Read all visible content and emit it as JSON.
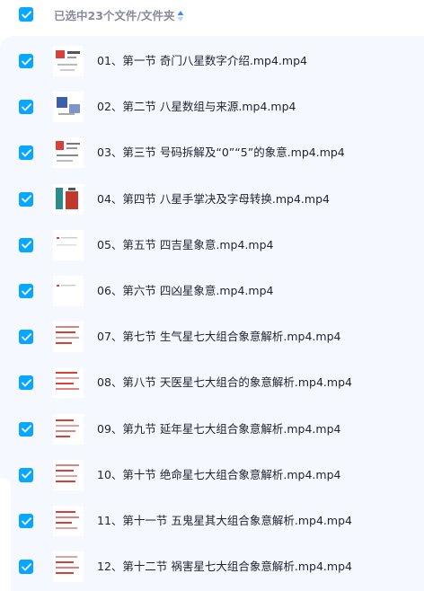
{
  "header": {
    "title": "已选中23个文件/文件夹",
    "checked": true,
    "sort_icon": "sort-up-down-icon",
    "accent_color": "#06a7ff"
  },
  "files": [
    {
      "name": "01、第一节 奇门八星数字介绍.mp4.mp4",
      "checked": true
    },
    {
      "name": "02、第二节 八星数组与来源.mp4.mp4",
      "checked": true
    },
    {
      "name": "03、第三节 号码拆解及“0”“5”的象意.mp4.mp4",
      "checked": true
    },
    {
      "name": "04、第四节 八星手掌决及字母转换.mp4.mp4",
      "checked": true
    },
    {
      "name": "05、第五节 四吉星象意.mp4.mp4",
      "checked": true
    },
    {
      "name": "06、第六节 四凶星象意.mp4.mp4",
      "checked": true
    },
    {
      "name": "07、第七节 生气星七大组合象意解析.mp4.mp4",
      "checked": true
    },
    {
      "name": "08、第八节 天医星七大组合的象意解析.mp4.mp4",
      "checked": true
    },
    {
      "name": "09、第九节 延年星七大组合象意解析.mp4.mp4",
      "checked": true
    },
    {
      "name": "10、第十节 绝命星七大组合象意解析.mp4.mp4",
      "checked": true
    },
    {
      "name": "11、第十一节 五鬼星其大组合象意解析.mp4.mp4",
      "checked": true
    },
    {
      "name": "12、第十二节 祸害星七大组合象意解析.mp4.mp4",
      "checked": true
    }
  ]
}
